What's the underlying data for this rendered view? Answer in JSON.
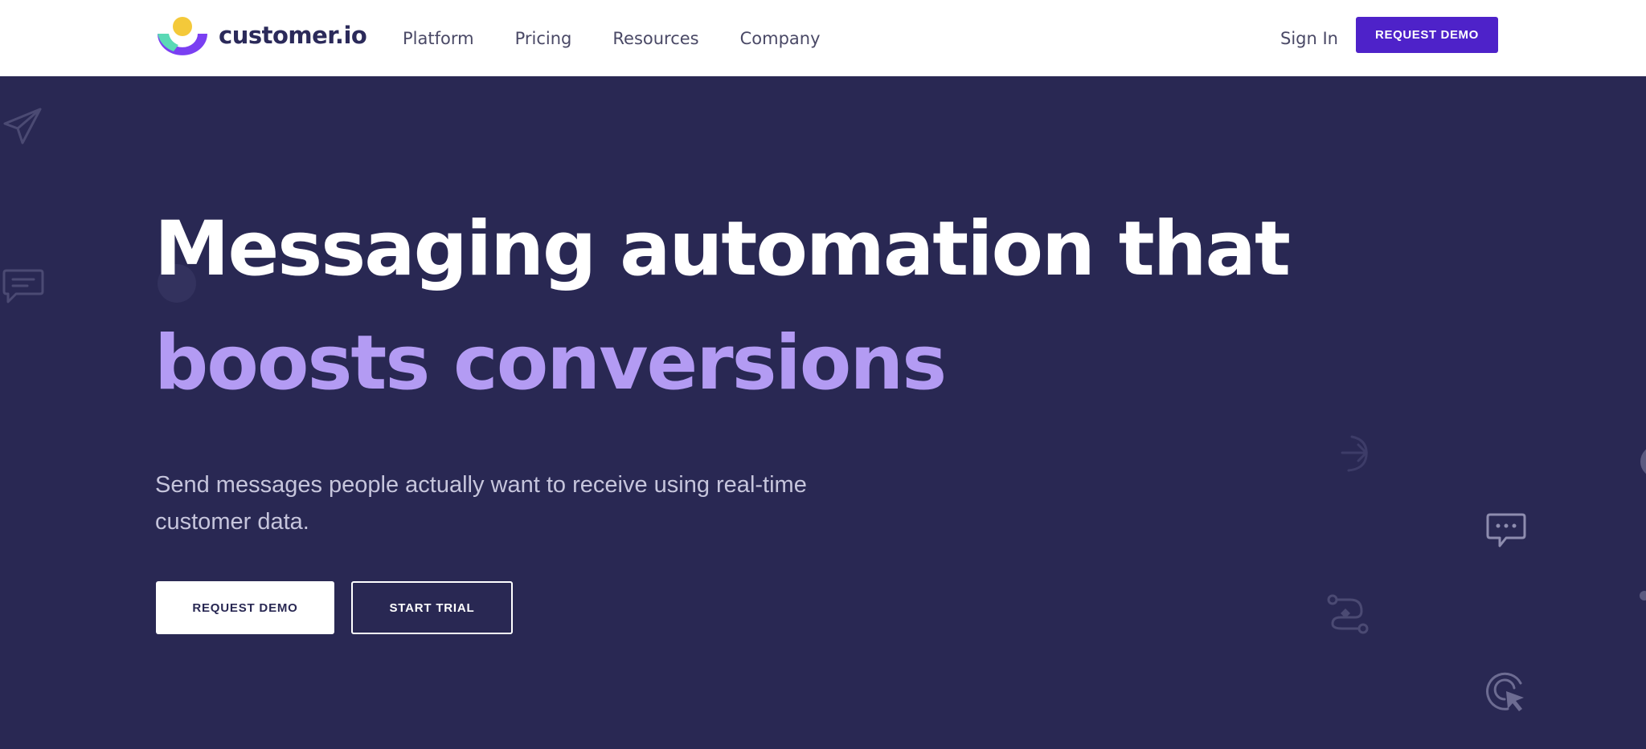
{
  "brand": {
    "name": "customer.io",
    "colors": {
      "accent": "#4e22c9",
      "hero_bg": "#292853",
      "highlight": "#b39bf3",
      "logo_yellow": "#f4c93a",
      "logo_teal": "#5ad9b5"
    }
  },
  "nav": {
    "links": [
      "Platform",
      "Pricing",
      "Resources",
      "Company"
    ],
    "sign_in": "Sign In",
    "request_demo": "REQUEST DEMO"
  },
  "hero": {
    "headline_line1": "Messaging automation that",
    "headline_line2": "boosts conversions",
    "subtext": "Send messages people actually want to receive using real-time customer data.",
    "cta_primary": "REQUEST DEMO",
    "cta_secondary": "START TRIAL"
  },
  "decor_icons": [
    "paper-plane-icon",
    "chat-bubble-icon",
    "retarget-icon",
    "typing-bubble-icon",
    "workflow-icon",
    "click-cursor-icon"
  ]
}
